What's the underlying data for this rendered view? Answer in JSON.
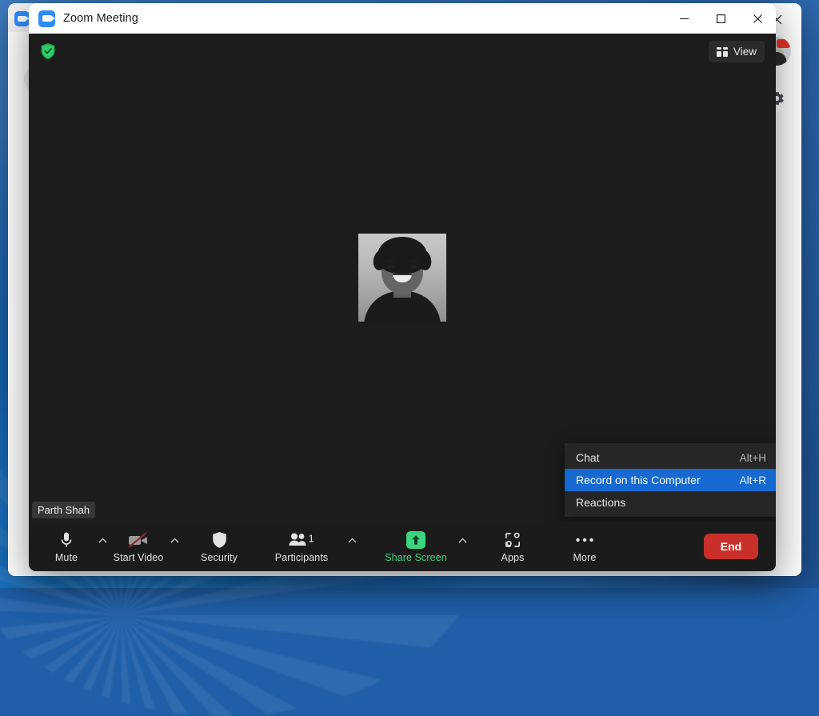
{
  "window": {
    "title": "Zoom Meeting",
    "app_icon": "zoom-camera-icon",
    "controls": {
      "minimize": "minimize-icon",
      "maximize": "maximize-icon",
      "close": "close-icon"
    }
  },
  "stage": {
    "security_badge": "shield-check-icon",
    "view_button": {
      "label": "View",
      "icon": "grid-icon"
    },
    "self_name": "Parth Shah"
  },
  "context_menu": {
    "items": [
      {
        "label": "Chat",
        "shortcut": "Alt+H",
        "highlighted": false
      },
      {
        "label": "Record on this Computer",
        "shortcut": "Alt+R",
        "highlighted": true
      },
      {
        "label": "Reactions",
        "shortcut": "",
        "highlighted": false
      }
    ]
  },
  "toolbar": {
    "mute": {
      "label": "Mute",
      "icon": "microphone-icon"
    },
    "video": {
      "label": "Start Video",
      "icon": "camera-off-icon"
    },
    "security": {
      "label": "Security",
      "icon": "shield-icon"
    },
    "participants": {
      "label": "Participants",
      "icon": "people-icon",
      "count": "1"
    },
    "share": {
      "label": "Share Screen",
      "icon": "share-up-arrow-icon"
    },
    "apps": {
      "label": "Apps",
      "icon": "apps-icon"
    },
    "more": {
      "label": "More",
      "icon": "ellipsis-icon"
    },
    "end": {
      "label": "End"
    }
  },
  "background_window": {
    "app_icon": "zoom-camera-icon",
    "rail": {
      "close": "close-icon",
      "avatar": "user-avatar-with-camera-badge",
      "settings": "gear-icon"
    }
  },
  "colors": {
    "accent_blue": "#2d8cff",
    "menu_highlight": "#1669d1",
    "share_green": "#3ad57e",
    "end_red": "#c9302c",
    "toolbar_bg": "#1b1b1b",
    "stage_bg": "#1c1c1c"
  }
}
